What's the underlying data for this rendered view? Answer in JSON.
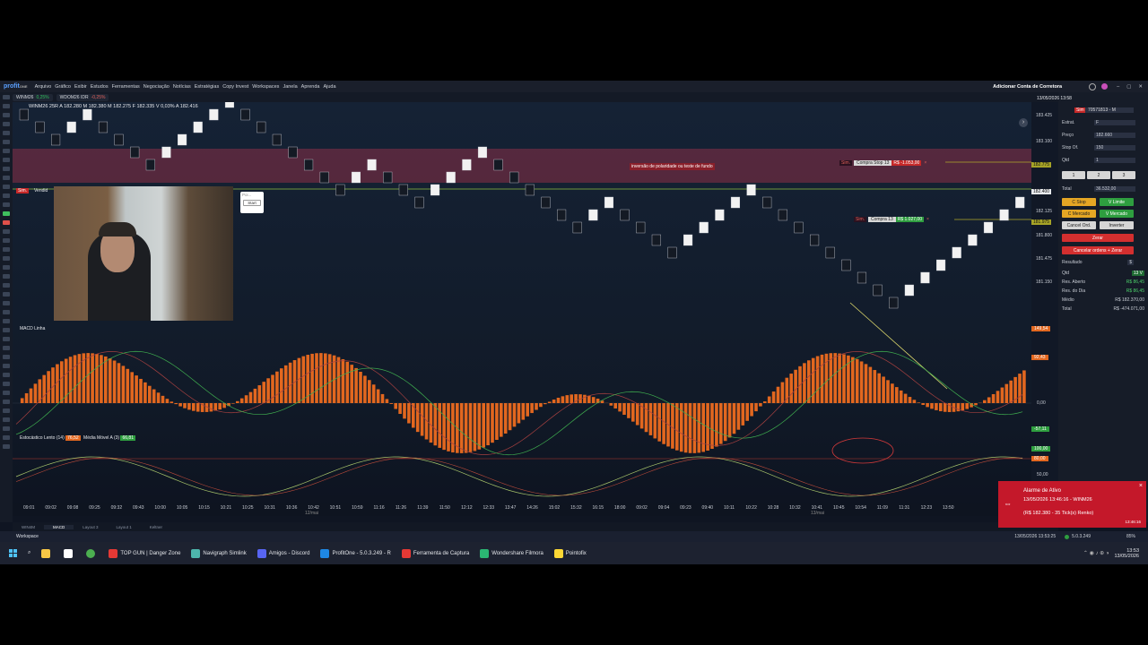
{
  "app": {
    "logo_main": "profit",
    "logo_sub": "ONE",
    "menus": [
      "Arquivo",
      "Gráfico",
      "Exibir",
      "Estudos",
      "Ferramentas",
      "Negociação",
      "Notícias",
      "Estratégias",
      "Copy Invest",
      "Workspaces",
      "Janela",
      "Aprenda",
      "Ajuda"
    ],
    "add_broker": "Adicionar Conta de Corretora"
  },
  "chart_tabs": [
    {
      "label": "WINM26",
      "change": "0,25%",
      "negative": false
    },
    {
      "label": "WDOM26 IDR",
      "change": "-0,25%",
      "negative": true
    }
  ],
  "chart": {
    "ohlc": "WINM26 25R  A 182.280 M 182.380 M 182.275 F 182.335 V 0,03% A 182.416",
    "mode_badge": "Sim.",
    "position_badge": "Vendid",
    "annotation": "inversão de polaridade ou teste de fundo",
    "popup_label": "Poi...",
    "popup_button": "Start",
    "macd_label": "MACD Linha",
    "stoch_label": "Estocástico Lento (14)",
    "stoch_value": "76,52",
    "ma_label": "Média Móvel A (3)",
    "ma_value": "66,81",
    "orders": [
      {
        "sim": "Sim.",
        "label": "Compra Stop 13",
        "pnl": "R$ -1.053,00",
        "close": "×"
      },
      {
        "sim": "Sim.",
        "label": "Compra 13",
        "pnl": "R$ 1.027,00",
        "close": "×"
      }
    ]
  },
  "price_axis": {
    "ticks": [
      "183.425",
      "183.100",
      "182.775",
      "182.400",
      "182.125",
      "181.975",
      "181.800",
      "181.475",
      "181.150"
    ],
    "macd_values": [
      "149,54",
      "92,43",
      "0,00",
      "-57,11"
    ],
    "stoch_values": [
      "100,00",
      "80,00",
      "50,00"
    ]
  },
  "time_axis": {
    "ticks": [
      "09:01",
      "09:02",
      "09:08",
      "09:25",
      "09:32",
      "09:43",
      "10:00",
      "10:05",
      "10:15",
      "10:21",
      "10:25",
      "10:31",
      "10:36",
      "10:42",
      "10:51",
      "10:59",
      "11:16",
      "11:26",
      "11:39",
      "11:50",
      "12:12",
      "12:33",
      "13:47",
      "14:26",
      "15:02",
      "15:32",
      "16:15",
      "18:00",
      "09:02",
      "09:04",
      "09:23",
      "09:40",
      "10:11",
      "10:22",
      "10:28",
      "10:32",
      "10:41",
      "10:45",
      "10:54",
      "11:09",
      "11:31",
      "12:23",
      "13:50"
    ],
    "day1": "12/mai",
    "day2": "13/mai"
  },
  "right_panel": {
    "datetime": "13/05/2026 13:58",
    "sim_badge": "Sim",
    "account": "70571813 - M",
    "strategy_label": "Estrat.",
    "strategy_value": "F",
    "price_label": "Preço",
    "price_value": "182.660",
    "stop_label": "Stop Of.",
    "stop_value": "150",
    "qty_label": "Qtd",
    "qty_value": "1",
    "qty_presets": [
      "1",
      "2",
      "3"
    ],
    "total_label": "Total",
    "total_value": "36.532,00",
    "buttons": {
      "c_stop": "C Stop",
      "v_limite": "V Limite",
      "c_mercado": "C Mercado",
      "v_mercado": "V Mercado",
      "cancel_ord": "Cancel Ord.",
      "inverter": "Inverter",
      "zerar": "Zerar",
      "cancel_zerar": "Cancelar ordens + Zerar"
    },
    "result_label": "Resultado",
    "result_currency": "$",
    "stats": [
      {
        "label": "Qtd",
        "value": "13 V"
      },
      {
        "label": "Res. Aberto",
        "value": "R$ 86,45"
      },
      {
        "label": "Res. do Dia",
        "value": "R$ 86,45"
      },
      {
        "label": "Médio",
        "value": "R$ 182.370,00"
      },
      {
        "label": "Total",
        "value": "R$ -474.071,00"
      }
    ]
  },
  "bottom_tabs": [
    "WIN4M",
    "MACD",
    "Layout 3",
    "Layout 1",
    "Keltner"
  ],
  "status": {
    "workspace": "Workspace",
    "datetime": "13/05/2026 13:53:25",
    "version": "5.0.3.249",
    "zoom": "85%"
  },
  "alert": {
    "title": "Alarme de Ativo",
    "line1": "13/05/2026 13:46:16 - WINM26",
    "line2": "(R$ 182.380 - 35 Tick(s) Renko)",
    "time": "13:46:16",
    "close": "×"
  },
  "taskbar": {
    "items": [
      {
        "label": "TOP GUN | Danger Zone",
        "color": "#e53935"
      },
      {
        "label": "Navigraph Simlink",
        "color": "#4db6ac"
      },
      {
        "label": "Amigos - Discord",
        "color": "#5865f2"
      },
      {
        "label": "ProfitOne - 5.0.3.249 - R",
        "color": "#1e88e5"
      },
      {
        "label": "Ferramenta de Captura",
        "color": "#e53935"
      },
      {
        "label": "Wondershare Filmora",
        "color": "#2bb673"
      },
      {
        "label": "Pointofix",
        "color": "#fdd835"
      }
    ],
    "clock_time": "13:53",
    "clock_date": "13/05/2026"
  }
}
